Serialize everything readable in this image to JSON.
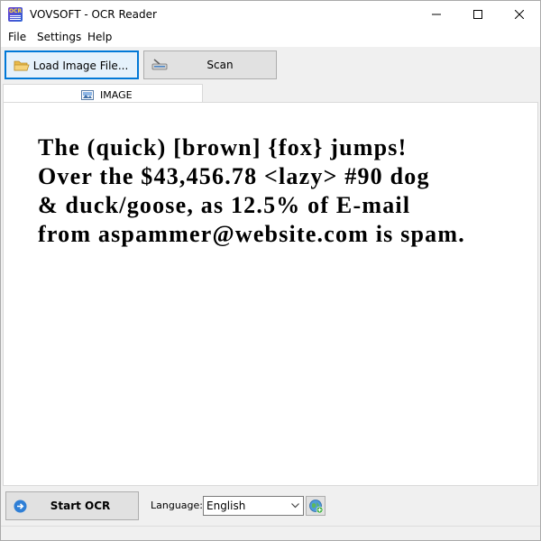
{
  "window": {
    "title": "VOVSOFT - OCR Reader",
    "app_icon_label": "OCR"
  },
  "menu": {
    "items": [
      {
        "label": "File"
      },
      {
        "label": "Settings"
      },
      {
        "label": "Help"
      }
    ]
  },
  "toolbar": {
    "load_label": "Load Image File...",
    "load_icon": "folder-icon",
    "scan_label": "Scan",
    "scan_icon": "scanner-icon"
  },
  "tabs": [
    {
      "label": "IMAGE",
      "icon": "image-icon",
      "selected": true
    }
  ],
  "image_text": {
    "lines": [
      "The (quick) [brown] {fox} jumps!",
      "Over the $43,456.78 <lazy> #90 dog",
      "& duck/goose, as 12.5% of E-mail",
      "from aspammer@website.com is spam."
    ]
  },
  "bottom": {
    "start_label": "Start OCR",
    "start_icon": "arrow-right-circle-icon",
    "language_label": "Language:",
    "language_value": "English",
    "globe_icon": "globe-add-icon"
  },
  "colors": {
    "accent": "#0078d7",
    "window_bg": "#f0f0f0",
    "button_bg": "#e1e1e1",
    "button_border": "#adadad"
  }
}
